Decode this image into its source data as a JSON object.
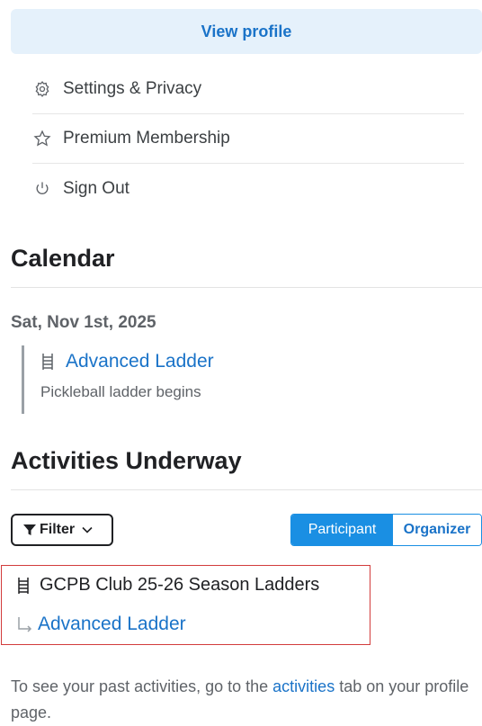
{
  "profile": {
    "view_profile_label": "View profile"
  },
  "menu": {
    "items": [
      {
        "label": "Settings & Privacy",
        "icon": "gear-icon"
      },
      {
        "label": "Premium Membership",
        "icon": "star-icon"
      },
      {
        "label": "Sign Out",
        "icon": "power-icon"
      }
    ]
  },
  "calendar": {
    "title": "Calendar",
    "date": "Sat, Nov 1st, 2025",
    "event": {
      "title": "Advanced Ladder",
      "description": "Pickleball ladder begins",
      "icon": "ladder-icon"
    }
  },
  "activities": {
    "title": "Activities Underway",
    "filter_label": "Filter",
    "toggle": {
      "active": "Participant",
      "inactive": "Organizer"
    },
    "item": {
      "parent": "GCPB Club 25-26 Season Ladders",
      "child": "Advanced Ladder"
    }
  },
  "footer": {
    "before": "To see your past activities, go to the",
    "link": "activities",
    "after": "tab on your profile page."
  },
  "colors": {
    "accent": "#1a73c8",
    "toggle_active": "#1a8fe3",
    "highlight_border": "#d23c3c",
    "button_bg": "#e5f1fb"
  }
}
